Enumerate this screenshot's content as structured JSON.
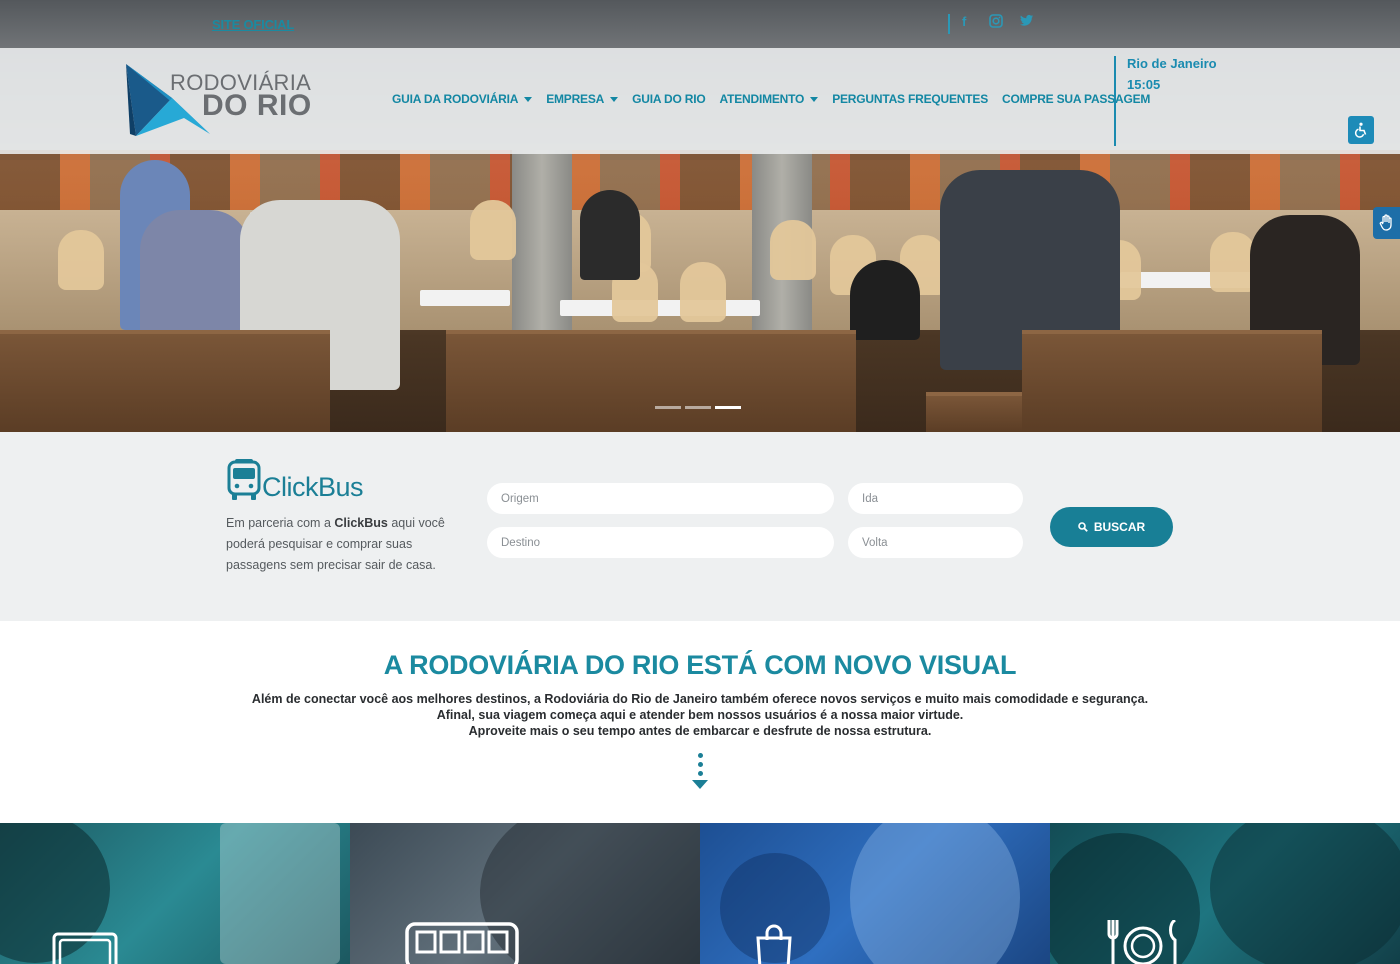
{
  "topbar": {
    "site_oficial": "SITE OFICIAL",
    "social": [
      "facebook-icon",
      "instagram-icon",
      "twitter-icon"
    ]
  },
  "header": {
    "logo_line1": "RODOVIÁRIA",
    "logo_line2": "DO RIO",
    "menu": [
      {
        "label": "GUIA DA RODOVIÁRIA",
        "dropdown": true
      },
      {
        "label": "EMPRESA",
        "dropdown": true
      },
      {
        "label": "GUIA DO RIO",
        "dropdown": false
      },
      {
        "label": "ATENDIMENTO",
        "dropdown": true
      },
      {
        "label": "PERGUNTAS FREQUENTES",
        "dropdown": false
      },
      {
        "label": "COMPRE SUA PASSAGEM",
        "dropdown": false
      }
    ],
    "city": "Rio de Janeiro",
    "time": "15:05"
  },
  "slider": {
    "count": 3,
    "active": 3
  },
  "search": {
    "brand": "ClickBus",
    "description_pre": "Em parceria com a ",
    "description_brand": "ClickBus",
    "description_post": " aqui você poderá pesquisar e comprar suas passagens sem precisar sair de casa.",
    "origem_placeholder": "Origem",
    "destino_placeholder": "Destino",
    "ida_placeholder": "Ida",
    "volta_placeholder": "Volta",
    "buscar_label": "BUSCAR"
  },
  "intro": {
    "title": "A RODOVIÁRIA DO RIO ESTÁ COM NOVO VISUAL",
    "line1": "Além de conectar você aos melhores destinos, a Rodoviária do Rio de Janeiro também oferece novos serviços e muito mais comodidade e segurança.",
    "line2": "Afinal, sua viagem começa aqui e atender bem nossos usuários é a nossa maior virtude.",
    "line3": "Aproveite mais o seu tempo antes de embarcar e desfrute de nossa estrutura."
  },
  "tiles": [
    "card-icon",
    "bus-icon",
    "shopping-bag-icon",
    "dining-icon"
  ],
  "colors": {
    "accent": "#1b8aa0",
    "button": "#187f96",
    "nav": "#1387a3"
  }
}
